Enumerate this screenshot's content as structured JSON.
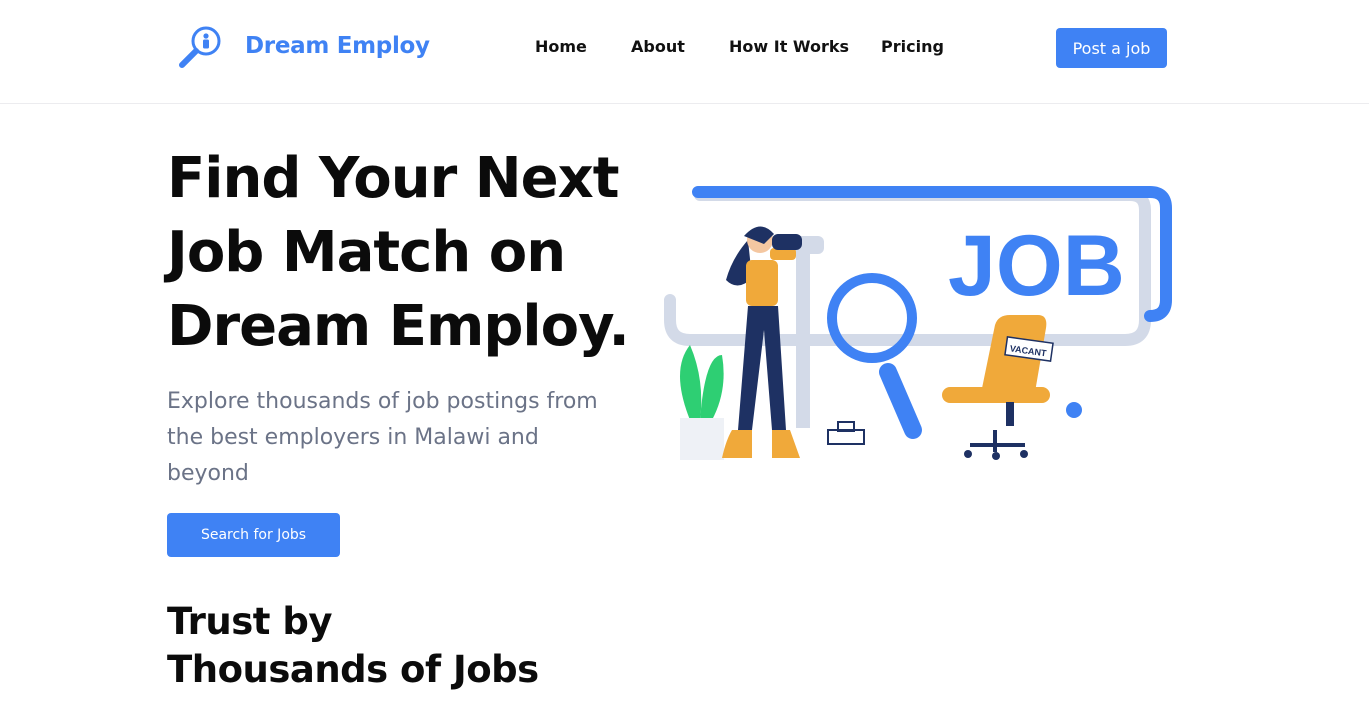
{
  "brand": {
    "name": "Dream Employ",
    "icon": "magnifier-person-icon"
  },
  "nav": {
    "items": [
      "Home",
      "About",
      "How It Works",
      "Pricing"
    ]
  },
  "header": {
    "cta_label": "Post a job"
  },
  "hero": {
    "title_lines": [
      "Find Your Next",
      "Job Match on",
      "Dream Employ."
    ],
    "subtitle_lines": [
      "Explore thousands of job postings from",
      "the best employers in Malawi and",
      "beyond"
    ],
    "cta_label": "Search for Jobs"
  },
  "illustration": {
    "board_text": "JOB",
    "sign_text": "VACANT"
  },
  "trust": {
    "title_lines": [
      "Trust by",
      "Thousands of Jobs"
    ]
  },
  "colors": {
    "accent": "#3f82f4",
    "text_dark": "#0b0b0b",
    "text_muted": "#6b7387",
    "orange": "#f0a93a",
    "navy": "#1e3163",
    "green": "#2ecf73",
    "grey_shape": "#d3dae8"
  }
}
